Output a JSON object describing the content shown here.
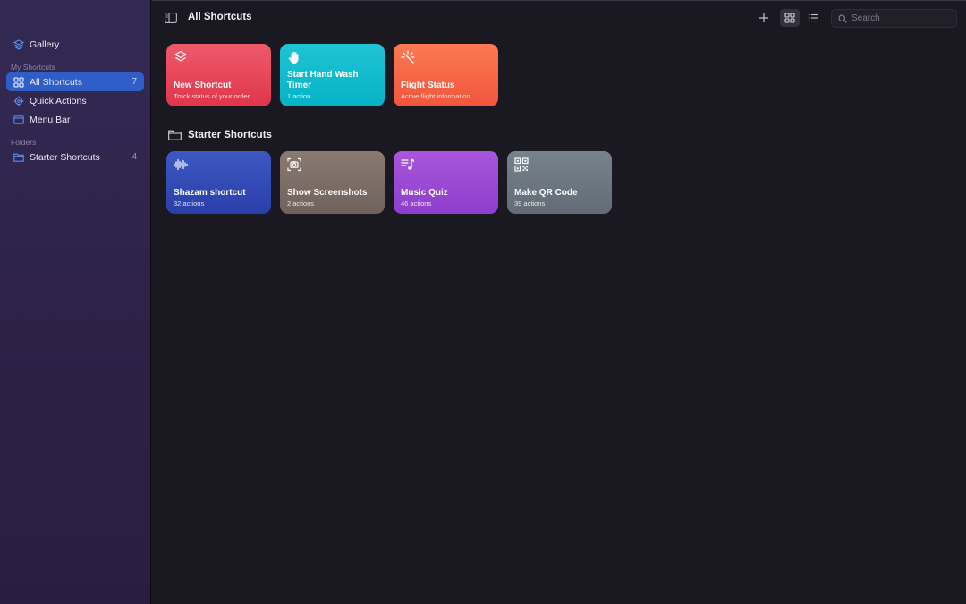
{
  "sidebar": {
    "gallery": "Gallery",
    "my_shortcuts_header": "My Shortcuts",
    "items": [
      {
        "label": "All Shortcuts",
        "count": "7",
        "icon": "grid-icon",
        "active": true
      },
      {
        "label": "Quick Actions",
        "count": "",
        "icon": "gear-icon",
        "active": false
      },
      {
        "label": "Menu Bar",
        "count": "",
        "icon": "menubar-icon",
        "active": false
      }
    ],
    "folders_header": "Folders",
    "folders": [
      {
        "label": "Starter Shortcuts",
        "count": "4",
        "icon": "folder-icon"
      }
    ]
  },
  "toolbar": {
    "title": "All Shortcuts",
    "search_placeholder": "Search",
    "view_mode": "grid"
  },
  "shortcuts": [
    {
      "name": "New Shortcut",
      "subtitle": "Track status of your order",
      "icon": "layers-icon",
      "color_top": "#ee5a6a",
      "color_bottom": "#e0354b"
    },
    {
      "name": "Start Hand Wash Timer",
      "subtitle": "1 action",
      "icon": "hand-icon",
      "color_top": "#1fc4d4",
      "color_bottom": "#05b3c6"
    },
    {
      "name": "Flight Status",
      "subtitle": "Active flight information",
      "icon": "sparkle-icon",
      "color_top": "#fb7a52",
      "color_bottom": "#f2553c"
    }
  ],
  "folder": {
    "title": "Starter Shortcuts",
    "shortcuts": [
      {
        "name": "Shazam shortcut",
        "subtitle": "32 actions",
        "icon": "waveform-icon",
        "color_top": "#3d58c2",
        "color_bottom": "#2a3ea8"
      },
      {
        "name": "Show Screenshots",
        "subtitle": "2 actions",
        "icon": "camera-viewfinder-icon",
        "color_top": "#8a7a72",
        "color_bottom": "#6f625c"
      },
      {
        "name": "Music Quiz",
        "subtitle": "46 actions",
        "icon": "music-list-icon",
        "color_top": "#a955dc",
        "color_bottom": "#8d3fcb"
      },
      {
        "name": "Make QR Code",
        "subtitle": "39 actions",
        "icon": "qrcode-icon",
        "color_top": "#77828d",
        "color_bottom": "#626c76"
      }
    ]
  }
}
